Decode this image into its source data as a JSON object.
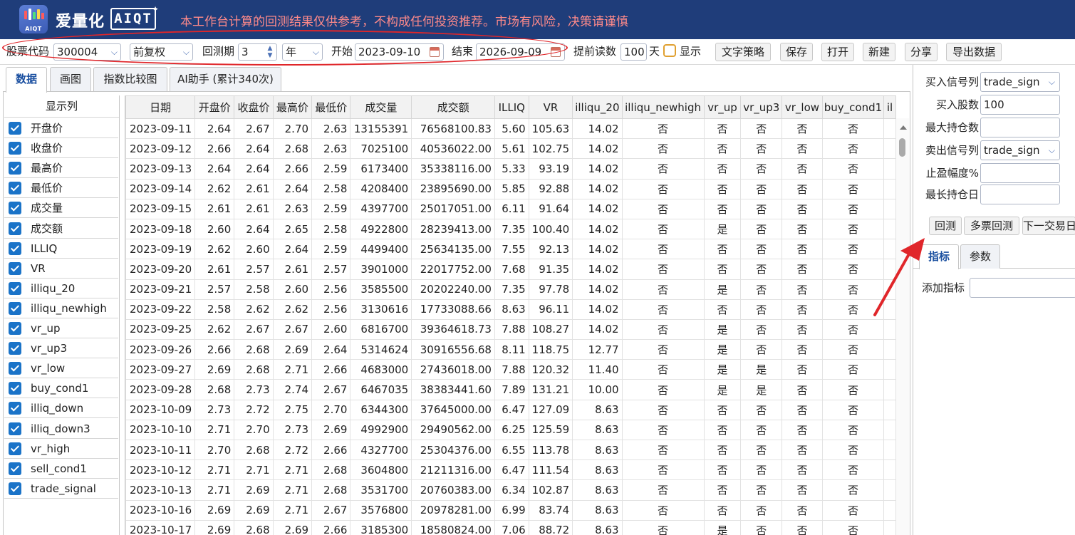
{
  "header": {
    "brand_cn": "爱量化",
    "brand_en": "AIQT",
    "logo_text": "AIQT",
    "disclaimer": "本工作台计算的回测结果仅供参考，不构成任何投资推荐。市场有风险，决策请谨慎"
  },
  "toolbar": {
    "stock_code_label": "股票代码",
    "stock_code_value": "300004",
    "adjust_value": "前复权",
    "period_label": "回测期",
    "period_value": "3",
    "period_unit": "年",
    "start_label": "开始",
    "start_date": "2023-09-10",
    "end_label": "结束",
    "end_date": "2026-09-09",
    "preload_label": "提前读数",
    "preload_value": "100",
    "preload_unit": "天",
    "show_label": "显示",
    "buttons": [
      "文字策略",
      "保存",
      "打开",
      "新建",
      "分享",
      "导出数据"
    ]
  },
  "tabs": [
    "数据",
    "画图",
    "指数比较图",
    "AI助手 (累计340次)"
  ],
  "columns_panel": {
    "title": "显示列",
    "items": [
      "开盘价",
      "收盘价",
      "最高价",
      "最低价",
      "成交量",
      "成交额",
      "ILLIQ",
      "VR",
      "illiqu_20",
      "illiqu_newhigh",
      "vr_up",
      "vr_up3",
      "vr_low",
      "buy_cond1",
      "illiq_down",
      "illiq_down3",
      "vr_high",
      "sell_cond1",
      "trade_signal"
    ]
  },
  "table": {
    "headers": [
      "日期",
      "开盘价",
      "收盘价",
      "最高价",
      "最低价",
      "成交量",
      "成交额",
      "ILLIQ",
      "VR",
      "illiqu_20",
      "illiqu_newhigh",
      "vr_up",
      "vr_up3",
      "vr_low",
      "buy_cond1",
      "il"
    ],
    "rows": [
      [
        "2023-09-11",
        "2.64",
        "2.67",
        "2.70",
        "2.63",
        "13155391",
        "76568100.83",
        "5.60",
        "105.63",
        "14.02",
        "否",
        "否",
        "否",
        "否",
        "否"
      ],
      [
        "2023-09-12",
        "2.66",
        "2.64",
        "2.68",
        "2.63",
        "7025100",
        "40536022.00",
        "5.61",
        "102.75",
        "14.02",
        "否",
        "否",
        "否",
        "否",
        "否"
      ],
      [
        "2023-09-13",
        "2.64",
        "2.64",
        "2.66",
        "2.59",
        "6173400",
        "35338116.00",
        "5.33",
        "93.19",
        "14.02",
        "否",
        "否",
        "否",
        "否",
        "否"
      ],
      [
        "2023-09-14",
        "2.62",
        "2.61",
        "2.64",
        "2.58",
        "4208400",
        "23895690.00",
        "5.85",
        "92.88",
        "14.02",
        "否",
        "否",
        "否",
        "否",
        "否"
      ],
      [
        "2023-09-15",
        "2.61",
        "2.61",
        "2.63",
        "2.59",
        "4397700",
        "25017051.00",
        "6.11",
        "91.64",
        "14.02",
        "否",
        "否",
        "否",
        "否",
        "否"
      ],
      [
        "2023-09-18",
        "2.60",
        "2.64",
        "2.65",
        "2.58",
        "4922800",
        "28239413.00",
        "7.35",
        "100.40",
        "14.02",
        "否",
        "是",
        "否",
        "否",
        "否"
      ],
      [
        "2023-09-19",
        "2.62",
        "2.60",
        "2.64",
        "2.59",
        "4499400",
        "25634135.00",
        "7.55",
        "92.13",
        "14.02",
        "否",
        "否",
        "否",
        "否",
        "否"
      ],
      [
        "2023-09-20",
        "2.61",
        "2.57",
        "2.61",
        "2.57",
        "3901000",
        "22017752.00",
        "7.68",
        "91.35",
        "14.02",
        "否",
        "否",
        "否",
        "否",
        "否"
      ],
      [
        "2023-09-21",
        "2.57",
        "2.58",
        "2.60",
        "2.56",
        "3585500",
        "20202240.00",
        "7.35",
        "97.78",
        "14.02",
        "否",
        "是",
        "否",
        "否",
        "否"
      ],
      [
        "2023-09-22",
        "2.58",
        "2.62",
        "2.62",
        "2.56",
        "3130616",
        "17733088.66",
        "8.63",
        "96.11",
        "14.02",
        "否",
        "否",
        "否",
        "否",
        "否"
      ],
      [
        "2023-09-25",
        "2.62",
        "2.67",
        "2.67",
        "2.60",
        "6816700",
        "39364618.73",
        "7.88",
        "108.27",
        "14.02",
        "否",
        "是",
        "否",
        "否",
        "否"
      ],
      [
        "2023-09-26",
        "2.66",
        "2.68",
        "2.69",
        "2.64",
        "5314624",
        "30916556.68",
        "8.11",
        "118.75",
        "12.77",
        "否",
        "是",
        "否",
        "否",
        "否"
      ],
      [
        "2023-09-27",
        "2.69",
        "2.68",
        "2.71",
        "2.66",
        "4683000",
        "27436018.00",
        "7.88",
        "120.32",
        "11.40",
        "否",
        "是",
        "是",
        "否",
        "否"
      ],
      [
        "2023-09-28",
        "2.68",
        "2.73",
        "2.74",
        "2.67",
        "6467035",
        "38383441.60",
        "7.89",
        "131.21",
        "10.00",
        "否",
        "是",
        "是",
        "否",
        "否"
      ],
      [
        "2023-10-09",
        "2.73",
        "2.72",
        "2.75",
        "2.70",
        "6344300",
        "37645000.00",
        "6.47",
        "127.09",
        "8.63",
        "否",
        "否",
        "否",
        "否",
        "否"
      ],
      [
        "2023-10-10",
        "2.71",
        "2.70",
        "2.73",
        "2.69",
        "4992900",
        "29490562.00",
        "6.25",
        "125.59",
        "8.63",
        "否",
        "否",
        "否",
        "否",
        "否"
      ],
      [
        "2023-10-11",
        "2.70",
        "2.68",
        "2.72",
        "2.66",
        "4327700",
        "25304376.00",
        "6.55",
        "113.78",
        "8.63",
        "否",
        "否",
        "否",
        "否",
        "否"
      ],
      [
        "2023-10-12",
        "2.71",
        "2.71",
        "2.71",
        "2.68",
        "3604800",
        "21211316.00",
        "6.47",
        "111.54",
        "8.63",
        "否",
        "否",
        "否",
        "否",
        "否"
      ],
      [
        "2023-10-13",
        "2.71",
        "2.69",
        "2.71",
        "2.68",
        "3531700",
        "20760383.00",
        "6.34",
        "102.87",
        "8.63",
        "否",
        "否",
        "否",
        "否",
        "否"
      ],
      [
        "2023-10-16",
        "2.69",
        "2.69",
        "2.71",
        "2.67",
        "3576800",
        "20978281.00",
        "6.99",
        "83.74",
        "8.63",
        "否",
        "否",
        "否",
        "否",
        "否"
      ],
      [
        "2023-10-17",
        "2.69",
        "2.68",
        "2.69",
        "2.66",
        "3185300",
        "18580824.00",
        "7.06",
        "88.72",
        "8.63",
        "否",
        "是",
        "否",
        "否",
        "否"
      ]
    ]
  },
  "right_panel": {
    "buy_signal_label": "买入信号列",
    "buy_signal_value": "trade_sign",
    "buy_shares_label": "买入股数",
    "buy_shares_value": "100",
    "max_pos_label": "最大持仓数",
    "max_pos_value": "",
    "sell_signal_label": "卖出信号列",
    "sell_signal_value": "trade_sign",
    "take_profit_label": "止盈幅度%",
    "take_profit_value": "",
    "max_hold_label": "最长持仓日",
    "max_hold_value": "",
    "buttons": [
      "回测",
      "多票回测",
      "下一交易日"
    ],
    "tabs": [
      "指标",
      "参数"
    ],
    "add_indicator_label": "添加指标",
    "add_indicator_value": ""
  },
  "colors": {
    "header_bg": "#1f3d7a",
    "disclaimer": "#ff8a8a",
    "annotation_red": "#e0262a",
    "checkbox_blue": "#1a73c8"
  }
}
